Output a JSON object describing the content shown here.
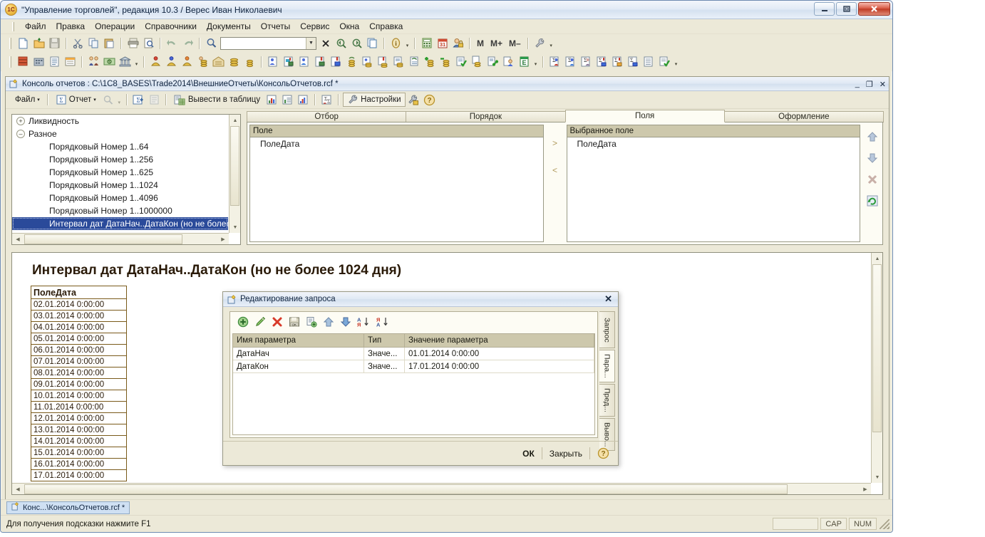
{
  "window": {
    "title": "\"Управление торговлей\", редакция 10.3 / Верес Иван Николаевич",
    "app_icon": "1c-logo-icon",
    "minimize": "–",
    "maximize": "❐",
    "close": "✕"
  },
  "menubar": {
    "items": [
      {
        "label": "Файл"
      },
      {
        "label": "Правка"
      },
      {
        "label": "Операции"
      },
      {
        "label": "Справочники"
      },
      {
        "label": "Документы"
      },
      {
        "label": "Отчеты"
      },
      {
        "label": "Сервис"
      },
      {
        "label": "Окна"
      },
      {
        "label": "Справка"
      }
    ]
  },
  "toolbar1": {
    "search_value": "",
    "memory_buttons": [
      "M",
      "M+",
      "M–"
    ]
  },
  "child_window": {
    "title": "Консоль отчетов : C:\\1C8_BASES\\Trade2014\\ВнешниеОтчеты\\КонсольОтчетов.rcf *",
    "minimize": "_",
    "restore": "❐",
    "close": "✕",
    "toolbar": {
      "file_label": "Файл",
      "report_label": "Отчет",
      "output_table_label": "Вывести в таблицу",
      "settings_label": "Настройки",
      "help_label": "?"
    }
  },
  "tree": {
    "nodes": [
      {
        "label": "Ликвидность",
        "level": 0,
        "twisty": "+",
        "selected": false
      },
      {
        "label": "Разное",
        "level": 0,
        "twisty": "–",
        "selected": false
      },
      {
        "label": "Порядковый Номер 1..64",
        "level": 1,
        "twisty": "",
        "selected": false
      },
      {
        "label": "Порядковый Номер 1..256",
        "level": 1,
        "twisty": "",
        "selected": false
      },
      {
        "label": "Порядковый Номер 1..625",
        "level": 1,
        "twisty": "",
        "selected": false
      },
      {
        "label": "Порядковый Номер 1..1024",
        "level": 1,
        "twisty": "",
        "selected": false
      },
      {
        "label": "Порядковый Номер 1..4096",
        "level": 1,
        "twisty": "",
        "selected": false
      },
      {
        "label": "Порядковый Номер 1..1000000",
        "level": 1,
        "twisty": "",
        "selected": false
      },
      {
        "label": "Интервал дат ДатаНач..ДатаКон (но не более",
        "level": 1,
        "twisty": "",
        "selected": true
      }
    ]
  },
  "tabs": {
    "items": [
      {
        "label": "Отбор",
        "active": false
      },
      {
        "label": "Порядок",
        "active": false
      },
      {
        "label": "Поля",
        "active": true
      },
      {
        "label": "Оформление",
        "active": false
      }
    ]
  },
  "fields_panel": {
    "available": {
      "header": "Поле",
      "items": [
        "ПолеДата"
      ]
    },
    "selected": {
      "header": "Выбранное поле",
      "items": [
        "ПолеДата"
      ]
    },
    "move_right_icon": ">",
    "move_left_icon": "<",
    "up_icon": "arrow-up-icon",
    "down_icon": "arrow-down-icon",
    "delete_icon": "delete-x-icon",
    "refresh_icon": "refresh-icon"
  },
  "report": {
    "title": "Интервал дат ДатаНач..ДатаКон (но не более 1024 дня)",
    "column_header": "ПолеДата",
    "rows": [
      "02.01.2014 0:00:00",
      "03.01.2014 0:00:00",
      "04.01.2014 0:00:00",
      "05.01.2014 0:00:00",
      "06.01.2014 0:00:00",
      "07.01.2014 0:00:00",
      "08.01.2014 0:00:00",
      "09.01.2014 0:00:00",
      "10.01.2014 0:00:00",
      "11.01.2014 0:00:00",
      "12.01.2014 0:00:00",
      "13.01.2014 0:00:00",
      "14.01.2014 0:00:00",
      "15.01.2014 0:00:00",
      "16.01.2014 0:00:00",
      "17.01.2014 0:00:00"
    ]
  },
  "dialog": {
    "title": "Редактирование запроса",
    "close_icon": "✕",
    "toolbar_icons": [
      "add-green-plus-icon",
      "edit-pencil-icon",
      "delete-red-x-icon",
      "save-ok-icon",
      "copy-add-icon",
      "move-up-icon",
      "move-down-icon",
      "sort-asc-icon",
      "sort-desc-icon"
    ],
    "table": {
      "columns": [
        "Имя параметра",
        "Тип",
        "Значение параметра"
      ],
      "rows": [
        {
          "name": "ДатаНач",
          "type": "Значе...",
          "value": "01.01.2014 0:00:00"
        },
        {
          "name": "ДатаКон",
          "type": "Значе...",
          "value": "17.01.2014 0:00:00"
        }
      ]
    },
    "vtabs": [
      {
        "label": "Запрос",
        "active": false
      },
      {
        "label": "Пара...",
        "active": true
      },
      {
        "label": "Пред...",
        "active": false
      },
      {
        "label": "Выво...",
        "active": false
      }
    ],
    "buttons": {
      "ok": "ОК",
      "close": "Закрыть",
      "help": "?"
    }
  },
  "taskbar": {
    "items": [
      {
        "label": "Конс...\\КонсольОтчетов.rcf *",
        "icon": "document-icon"
      }
    ]
  },
  "statusbar": {
    "hint": "Для получения подсказки нажмите F1",
    "indicators": [
      "CAP",
      "NUM"
    ]
  },
  "colors": {
    "chrome": "#ece9d8",
    "selection": "#2a4a9a",
    "list_header": "#cdc8ac",
    "accent_title": "#10243f"
  }
}
